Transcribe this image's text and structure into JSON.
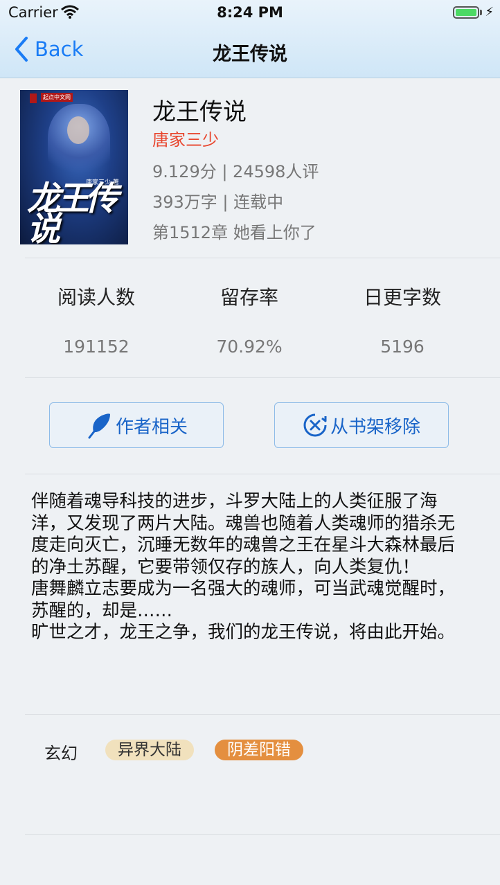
{
  "status_bar": {
    "carrier": "Carrier",
    "time": "8:24 PM"
  },
  "nav": {
    "back_label": "Back",
    "title": "龙王传说"
  },
  "cover": {
    "title_art": "龙王传说",
    "author_art": "唐家三少 著",
    "publisher_art": "起点中文网"
  },
  "book": {
    "title": "龙王传说",
    "author": "唐家三少",
    "rating": "9.129分 | 24598人评",
    "words_status": "393万字 | 连载中",
    "latest_chapter": "第1512章 她看上你了"
  },
  "stats": [
    {
      "label": "阅读人数",
      "value": "191152"
    },
    {
      "label": "留存率",
      "value": "70.92%"
    },
    {
      "label": "日更字数",
      "value": "5196"
    }
  ],
  "actions": {
    "author_button": "作者相关",
    "remove_button": "从书架移除"
  },
  "description": "伴随着魂导科技的进步，斗罗大陆上的人类征服了海洋，又发现了两片大陆。魂兽也随着人类魂师的猎杀无度走向灭亡，沉睡无数年的魂兽之王在星斗大森林最后的净土苏醒，它要带领仅存的族人，向人类复仇！\n唐舞麟立志要成为一名强大的魂师，可当武魂觉醒时，苏醒的，却是……\n旷世之才，龙王之争，我们的龙王传说，将由此开始。",
  "tags": {
    "category": "玄幻",
    "items": [
      {
        "label": "异界大陆",
        "color": "#f1e1bd",
        "text_color": "#333333"
      },
      {
        "label": "阴差阳错",
        "color": "#e48f3f",
        "text_color": "#ffffff"
      }
    ]
  },
  "colors": {
    "accent": "#1a7cf5",
    "author_red": "#e8452d",
    "battery_green": "#4cd964"
  },
  "icons": [
    "wifi-icon",
    "battery-icon",
    "chevron-left-icon",
    "feather-icon",
    "remove-circle-icon"
  ]
}
